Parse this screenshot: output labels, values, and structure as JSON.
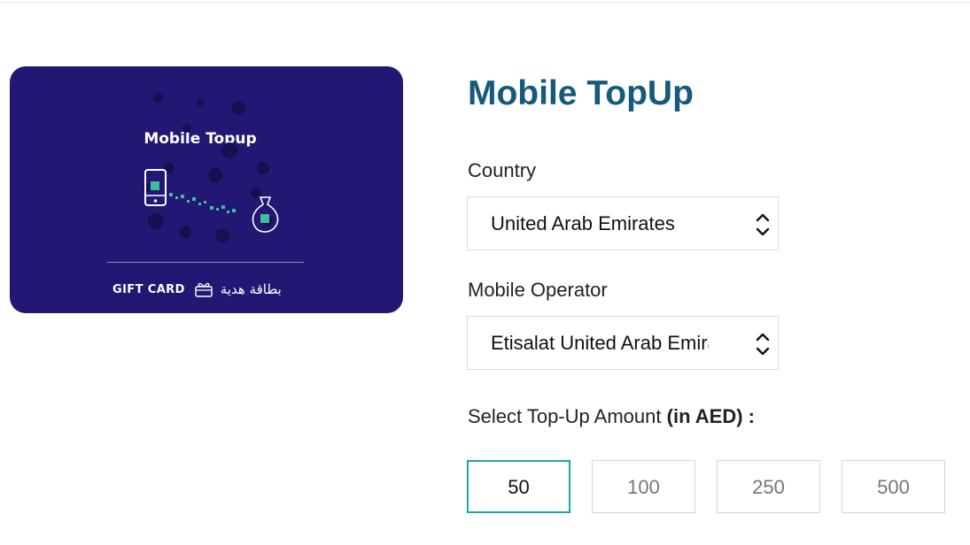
{
  "card": {
    "title": "Mobile Topup",
    "gift_card_label": "GIFT CARD",
    "arabic_label": "بطاقة هدية",
    "background_color": "#221874",
    "accent_color": "#3dbf9a",
    "icons": [
      "phone-icon",
      "money-bag-icon",
      "gift-icon"
    ]
  },
  "product": {
    "title": "Mobile TopUp",
    "title_color": "#155a7a"
  },
  "country": {
    "label": "Country",
    "selected": "United Arab Emirates"
  },
  "operator": {
    "label": "Mobile Operator",
    "selected": "Etisalat United Arab Emirates"
  },
  "amount": {
    "label_prefix": "Select Top-Up Amount",
    "label_bold": "(in AED) :",
    "options": [
      "50",
      "100",
      "250",
      "500"
    ],
    "selected": "50",
    "selected_border_color": "#1ba6a8"
  }
}
